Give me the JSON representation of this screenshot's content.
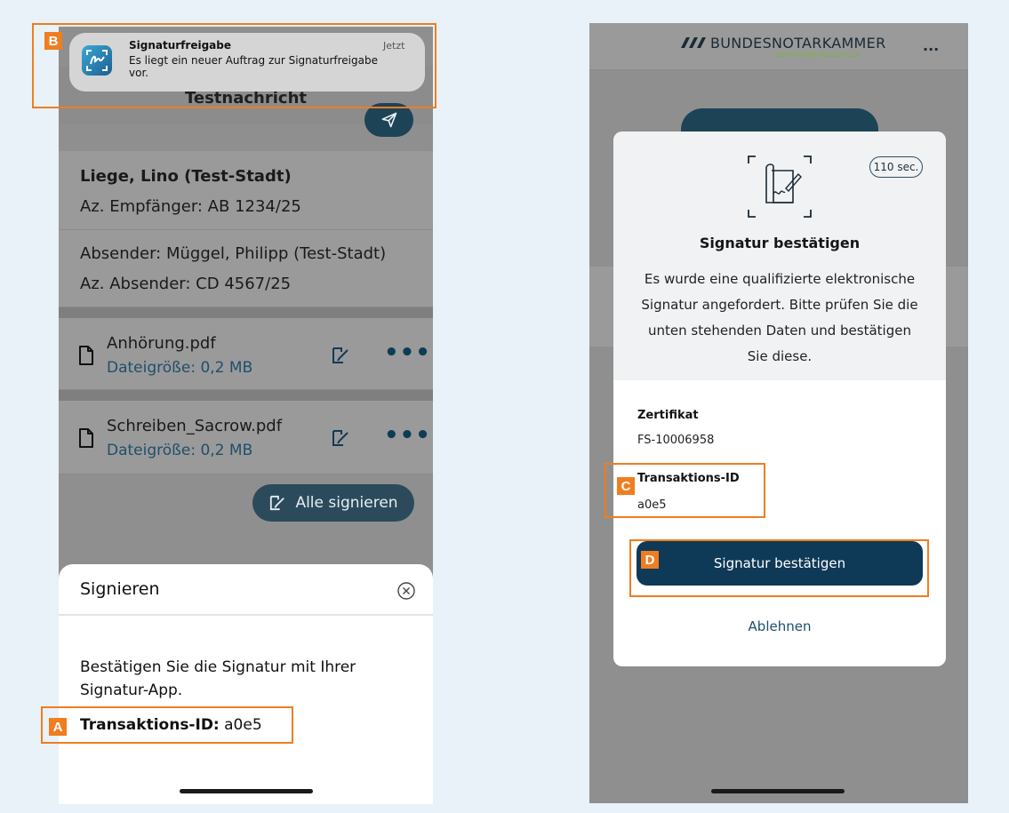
{
  "left": {
    "notification": {
      "app_name": "Signaturfreigabe",
      "time": "Jetzt",
      "line1": "Es liegt ein neuer Auftrag zur Signaturfreigabe",
      "line2": "vor."
    },
    "header_title": "Testnachricht",
    "recipient_name": "Liege, Lino (Test-Stadt)",
    "recipient_ref": "Az. Empfänger: AB 1234/25",
    "sender_name": "Absender: Müggel, Philipp (Test-Stadt)",
    "sender_ref": "Az. Absender: CD 4567/25",
    "files": [
      {
        "name": "Anhörung.pdf",
        "size": "Dateigröße: 0,2 MB"
      },
      {
        "name": "Schreiben_Sacrow.pdf",
        "size": "Dateigröße: 0,2 MB"
      }
    ],
    "sign_all_label": "Alle signieren",
    "sheet": {
      "title": "Signieren",
      "text_line1": "Bestätigen Sie die Signatur mit Ihrer",
      "text_line2": "Signatur-App.",
      "tx_label": "Transaktions-ID:",
      "tx_value": "a0e5"
    }
  },
  "right": {
    "brand": "BUNDESNOTARKAMMER",
    "brand_sub": "ZERTIFIZIERUNGSSTELLE",
    "menu_label": "...",
    "timer": "110 sec.",
    "title": "Signatur bestätigen",
    "desc_lines": [
      "Es wurde eine qualifizierte elektronische",
      "Signatur angefordert. Bitte prüfen Sie die",
      "unten stehenden Daten und bestätigen",
      "Sie diese."
    ],
    "cert_label": "Zertifikat",
    "cert_value": "FS-10006958",
    "tx_label": "Transaktions-ID",
    "tx_value": "a0e5",
    "confirm_label": "Signatur bestätigen",
    "reject_label": "Ablehnen"
  },
  "callouts": {
    "a": "A",
    "b": "B",
    "c": "C",
    "d": "D"
  },
  "colors": {
    "highlight": "#f07d1f",
    "primary": "#0e3a57",
    "brand_green": "#7bb33a"
  }
}
